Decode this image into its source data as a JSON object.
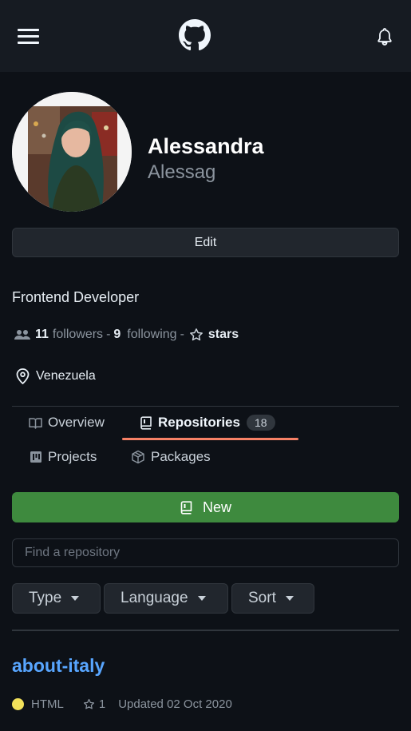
{
  "header": {
    "menu_icon": "hamburger-icon",
    "logo_icon": "github-logo-icon",
    "notification_icon": "bell-icon"
  },
  "profile": {
    "avatar_icon": "avatar-photo",
    "name": "Alessandra",
    "login": "Alessag",
    "edit_label": "Edit",
    "bio": "Frontend Developer",
    "followers_count": "11",
    "followers_label": "followers",
    "following_count": "9",
    "following_label": "following",
    "separator": "-",
    "stars_label": "stars",
    "location": "Venezuela"
  },
  "tabs": [
    {
      "label": "Overview",
      "icon": "book-open-icon",
      "active": false
    },
    {
      "label": "Repositories",
      "icon": "repo-icon",
      "active": true,
      "count": "18"
    },
    {
      "label": "Projects",
      "icon": "project-icon",
      "active": false
    },
    {
      "label": "Packages",
      "icon": "package-icon",
      "active": false
    }
  ],
  "repos_toolbar": {
    "new_label": "New",
    "search_placeholder": "Find a repository",
    "search_value": "",
    "filters": [
      "Type",
      "Language",
      "Sort"
    ]
  },
  "repositories": [
    {
      "name": "about-italy",
      "language": "HTML",
      "language_color": "#f1e05a",
      "stars": "1",
      "updated": "Updated 02 Oct 2020"
    }
  ],
  "colors": {
    "background": "#0d1117",
    "header": "#161b22",
    "accent_link": "#58a6ff",
    "new_button": "#3e8a3e",
    "tab_underline": "#f78166"
  }
}
